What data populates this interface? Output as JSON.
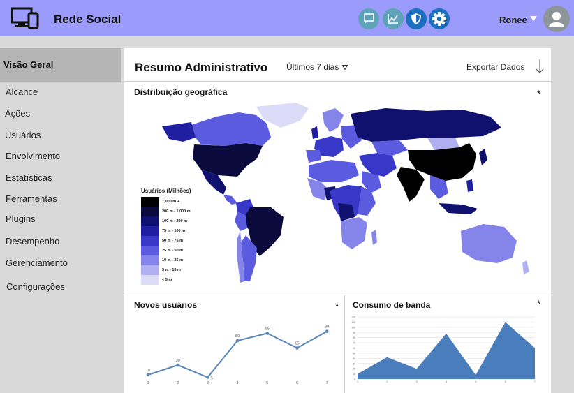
{
  "app": {
    "title": "Rede Social"
  },
  "toolbar": {
    "icons": [
      "chat-icon",
      "analytics-icon",
      "shield-icon",
      "gear-icon"
    ]
  },
  "user": {
    "name": "Ronee"
  },
  "sidebar": {
    "active": "Visão Geral",
    "items": [
      "Alcance",
      "Ações",
      "Usuários",
      "Envolvimento",
      "Estatísticas",
      "Ferramentas",
      "Plugins",
      "Desempenho",
      "Gerenciamento",
      "Configurações"
    ]
  },
  "header": {
    "title": "Resumo Administrativo",
    "range": "Últimos 7 dias",
    "export": "Exportar Dados"
  },
  "map_panel": {
    "title": "Distribuição geográfica",
    "star": "*",
    "legend_title": "Usuários (Milhões)",
    "legend": [
      {
        "label": "1,000 m +",
        "color": "#000000"
      },
      {
        "label": "200 m - 1,000 m",
        "color": "#0a0a3c"
      },
      {
        "label": "100 m - 200 m",
        "color": "#10106e"
      },
      {
        "label": "75 m - 100 m",
        "color": "#1f1fa0"
      },
      {
        "label": "50 m - 75 m",
        "color": "#3838c8"
      },
      {
        "label": "25 m - 50 m",
        "color": "#5b5be0"
      },
      {
        "label": "10 m - 25 m",
        "color": "#8484ea"
      },
      {
        "label": "5 m - 10 m",
        "color": "#b0b0f0"
      },
      {
        "label": "< 5 m",
        "color": "#dcdcf8"
      }
    ]
  },
  "new_users_panel": {
    "title": "Novos usuários",
    "star": "*"
  },
  "bandwidth_panel": {
    "title": "Consumo de banda",
    "star": "*"
  },
  "chart_data": [
    {
      "type": "line",
      "x": [
        1,
        2,
        3,
        4,
        5,
        6,
        7
      ],
      "values": [
        10,
        30,
        5,
        80,
        95,
        65,
        99
      ],
      "color": "#5b86b8"
    },
    {
      "type": "area",
      "x": [
        1,
        2,
        3,
        4,
        5,
        6,
        7
      ],
      "values": [
        10,
        42,
        20,
        88,
        8,
        110,
        60
      ],
      "ylim": [
        0,
        120
      ],
      "yticks": [
        0,
        10,
        20,
        30,
        40,
        50,
        60,
        70,
        80,
        90,
        100,
        110,
        120
      ],
      "color": "#4a7dbb"
    }
  ]
}
